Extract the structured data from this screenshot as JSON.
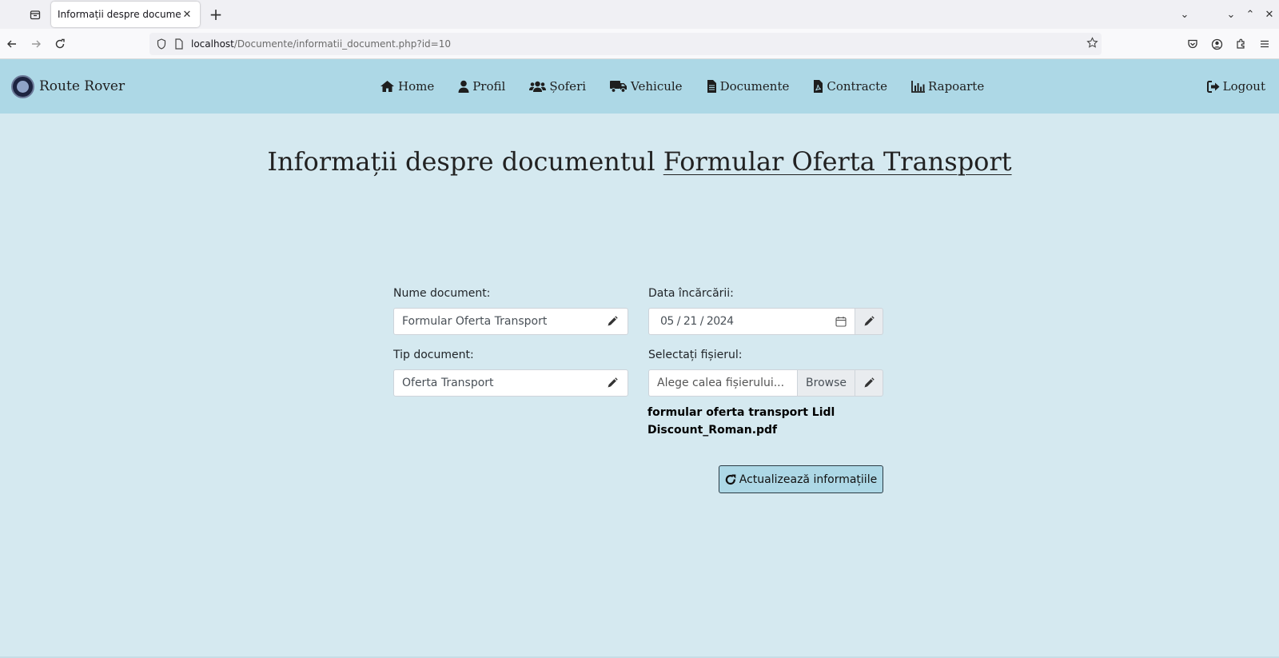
{
  "browser": {
    "tab_title": "Informații despre document",
    "url_host": "localhost",
    "url_path": "/Documente/informatii_document.php?id=10"
  },
  "app": {
    "brand": "Route Rover",
    "menu": [
      {
        "label": "Home",
        "icon": "home-icon"
      },
      {
        "label": "Profil",
        "icon": "user-icon"
      },
      {
        "label": "Șoferi",
        "icon": "users-icon"
      },
      {
        "label": "Vehicule",
        "icon": "truck-icon"
      },
      {
        "label": "Documente",
        "icon": "document-icon"
      },
      {
        "label": "Contracte",
        "icon": "pdf-file-icon"
      },
      {
        "label": "Rapoarte",
        "icon": "bar-chart-icon"
      }
    ],
    "logout": "Logout"
  },
  "page": {
    "title_prefix": "Informații despre documentul",
    "title_doc": "Formular Oferta Transport"
  },
  "form": {
    "name_label": "Nume document:",
    "name_value": "Formular Oferta Transport",
    "type_label": "Tip document:",
    "type_value": "Oferta Transport",
    "date_label": "Data încărcării:",
    "date_value": "05 / 21 / 2024",
    "file_label": "Selectați fișierul:",
    "file_placeholder": "Alege calea fișierului...",
    "browse": "Browse",
    "current_file": "formular oferta transport Lidl Discount_Roman.pdf",
    "update_button": "Actualizează informațiile"
  }
}
